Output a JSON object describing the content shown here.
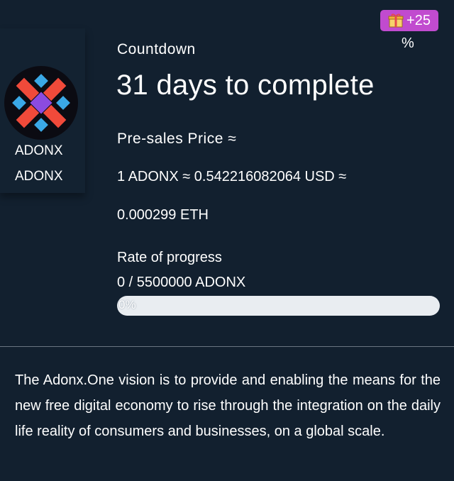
{
  "token": {
    "name_line1": "ADONX",
    "name_line2": "ADONX",
    "logo_icon": "adonx-logo-icon"
  },
  "bonus": {
    "icon": "gift-icon",
    "value": "+25",
    "unit": "%"
  },
  "countdown": {
    "label": "Countdown",
    "value": "31 days to complete"
  },
  "price": {
    "label": "Pre-sales Price ≈",
    "usd_line": "1 ADONX ≈ 0.542216082064 USD ≈",
    "eth_line": "0.000299 ETH"
  },
  "progress": {
    "label": "Rate of progress",
    "amount": "0 / 5500000 ADONX",
    "percent_text": "0%",
    "fraction": 0
  },
  "description": "The Adonx.One vision is to provide and enabling the means for the new free digital economy to rise through the integration on the daily life reality of consumers and businesses, on a global scale.",
  "colors": {
    "background": "#12202f",
    "bonus_badge": "#c14bcf",
    "progress_track": "#e9edf1",
    "logo_red": "#f04a3a",
    "logo_blue": "#3aa8e6",
    "logo_purple": "#8b4be0"
  }
}
